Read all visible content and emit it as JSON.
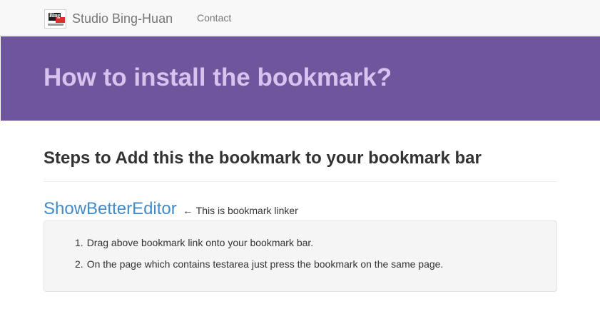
{
  "navbar": {
    "brand_name": "Studio Bing-Huan",
    "logo_text": "Bing",
    "contact_label": "Contact"
  },
  "hero": {
    "title": "How to install the bookmark?"
  },
  "main": {
    "steps_title": "Steps to Add this the bookmark to your bookmark bar",
    "bookmark_link_label": "ShowBetterEditor",
    "bookmark_arrow": "←",
    "bookmark_note": "This is bookmark linker",
    "steps": [
      {
        "number": "1.",
        "text": "Drag above bookmark link onto your bookmark bar."
      },
      {
        "number": "2.",
        "text": "On the page which contains testarea just press the bookmark on the same page."
      }
    ]
  },
  "colors": {
    "hero_background": "#6f559c",
    "hero_text": "#d6c4ef",
    "link": "#428bca",
    "navbar_background": "#f8f8f8"
  },
  "icons": {
    "brand_logo": "studio-logo-icon"
  }
}
